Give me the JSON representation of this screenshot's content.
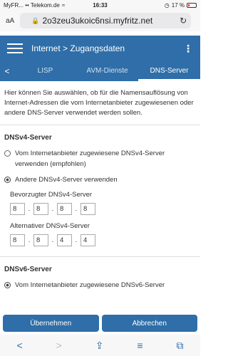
{
  "status": {
    "carrier": "MyFR... •• Telekom.de",
    "time": "16:33",
    "battery": "17 %",
    "battery_level": 0.17
  },
  "browser": {
    "aa": "aA",
    "url": "2o3zeu3ukoic6nsi.myfritz.net",
    "reload": "↻"
  },
  "appbar": {
    "title": "Internet > Zugangsdaten"
  },
  "tabs": {
    "back": "<",
    "items": [
      "LISP",
      "AVM-Dienste",
      "DNS-Server"
    ],
    "active": 2
  },
  "intro": "Hier können Sie auswählen, ob für die Namensauflösung von Internet-Adressen die vom Internetanbieter zugewiesenen oder andere DNS-Server verwendet werden sollen.",
  "dnsv4": {
    "title": "DNSv4-Server",
    "option1": "Vom Internetanbieter zugewiesene DNSv4-Server verwenden (empfohlen)",
    "option2": "Andere DNSv4-Server verwenden",
    "preferred_label": "Bevorzugter DNSv4-Server",
    "preferred": [
      "8",
      "8",
      "8",
      "8"
    ],
    "alternative_label": "Alternativer DNSv4-Server",
    "alternative": [
      "8",
      "8",
      "4",
      "4"
    ]
  },
  "dnsv6": {
    "title": "DNSv6-Server",
    "option1": "Vom Internetanbieter zugewiesene DNSv6-Server"
  },
  "buttons": {
    "apply": "Übernehmen",
    "cancel": "Abbrechen"
  },
  "toolbar": {
    "back": "<",
    "forward": ">",
    "share": "⇪",
    "bookmarks": "≡",
    "tabs": "⧉"
  }
}
